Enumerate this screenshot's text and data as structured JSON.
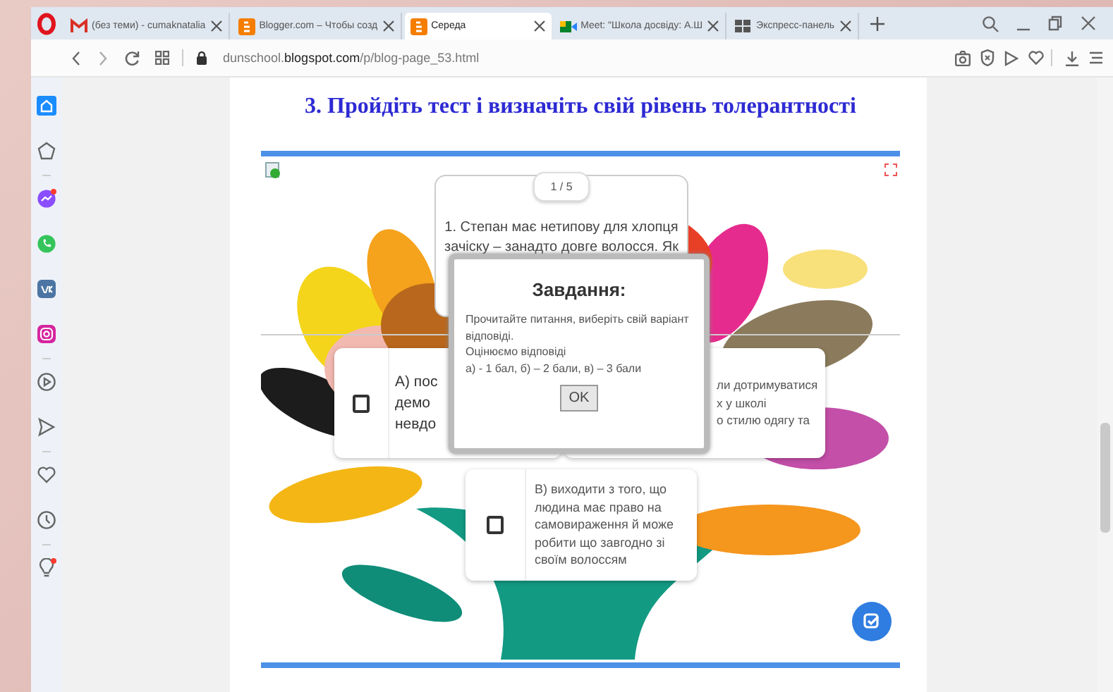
{
  "tabs": [
    {
      "kind": "mail",
      "label": "(без теми) - cumaknatalia",
      "selected": false
    },
    {
      "kind": "blog",
      "label": "Blogger.com – Чтобы созд",
      "selected": false
    },
    {
      "kind": "blog",
      "label": "Середа",
      "selected": true
    },
    {
      "kind": "meet",
      "label": "Meet: \"Школа досвіду: А.Ш",
      "selected": false
    },
    {
      "kind": "grid",
      "label": "Экспресс-панель",
      "selected": false
    }
  ],
  "address_bar": {
    "url": "dunschool.**blogspot.com**/p/blog-page_53.html"
  },
  "page": {
    "heading": "3. Пройдіть тест і визначіть свій рівень толерантності",
    "quiz": {
      "counter": "1 / 5",
      "question_lines": [
        "1. Степан має нетипову для хлопця",
        "зачіску – занадто довге волосся. Як"
      ],
      "options": [
        {
          "kind": "large",
          "checked": false,
          "lines": [
            "А) пос",
            "демо",
            "невдо"
          ]
        },
        {
          "kind": "small",
          "lines": [
            "ли дотримуватися",
            "х у школі",
            "о стилю одягу та"
          ]
        },
        {
          "kind": "small",
          "checked": false,
          "lines": [
            "В) виходити з того, що",
            "людина має право на",
            "самовираження й може",
            "робити що завгодно зі",
            "своїм волоссям"
          ]
        }
      ],
      "dialog": {
        "title": "Завдання:",
        "lines": [
          "Прочитайте питання, виберіть свій варіант",
          "відповіді.",
          "Оцінюємо відповіді",
          "а) - 1 бал, б) – 2 бали, в) – 3 бали"
        ],
        "button": "OK"
      }
    }
  }
}
